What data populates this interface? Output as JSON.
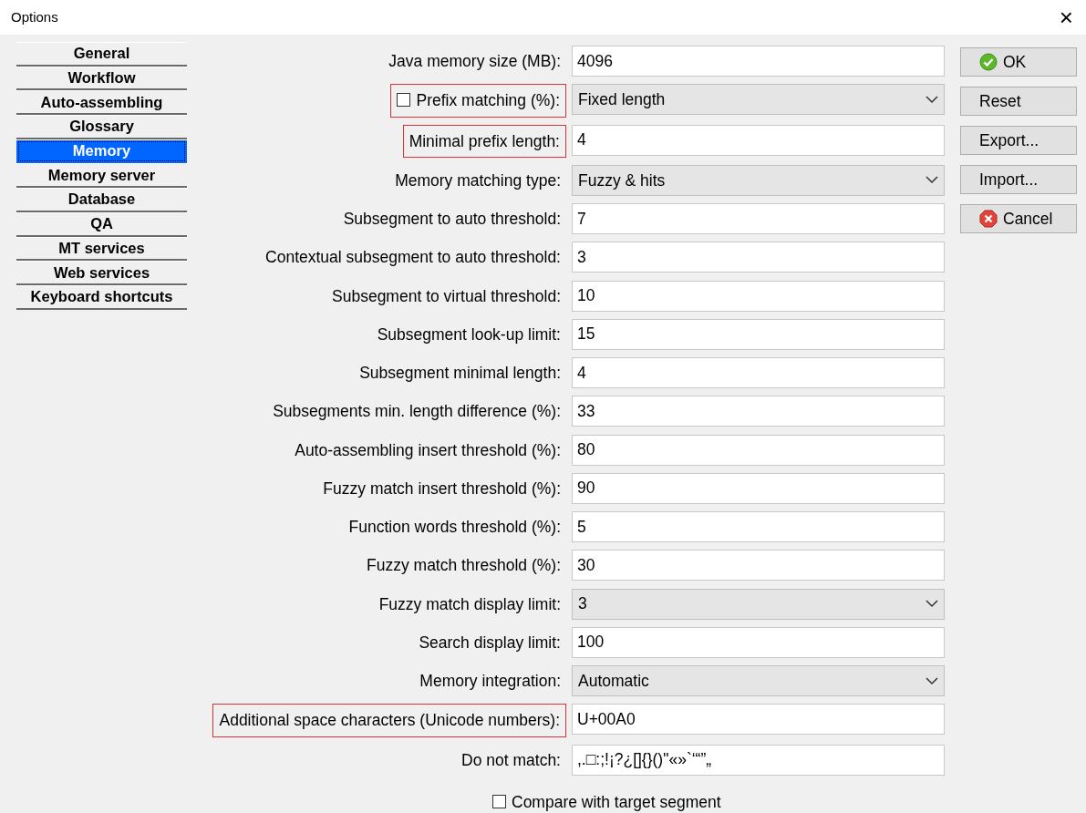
{
  "window": {
    "title": "Options",
    "close": "×"
  },
  "sidebar": {
    "items": [
      {
        "label": "General",
        "selected": false
      },
      {
        "label": "Workflow",
        "selected": false
      },
      {
        "label": "Auto-assembling",
        "selected": false
      },
      {
        "label": "Glossary",
        "selected": false
      },
      {
        "label": "Memory",
        "selected": true
      },
      {
        "label": "Memory server",
        "selected": false
      },
      {
        "label": "Database",
        "selected": false
      },
      {
        "label": "QA",
        "selected": false
      },
      {
        "label": "MT services",
        "selected": false
      },
      {
        "label": "Web services",
        "selected": false
      },
      {
        "label": "Keyboard shortcuts",
        "selected": false
      }
    ]
  },
  "settings": [
    {
      "label": "Java memory size (MB):",
      "kind": "text",
      "value": "4096",
      "highlighted": false
    },
    {
      "label": "Prefix matching (%):",
      "kind": "select",
      "value": "Fixed length",
      "highlighted": true,
      "checked": false
    },
    {
      "label": "Minimal prefix length:",
      "kind": "text",
      "value": "4",
      "highlighted": true
    },
    {
      "label": "Memory matching type:",
      "kind": "select",
      "value": "Fuzzy & hits",
      "highlighted": false
    },
    {
      "label": "Subsegment to auto threshold:",
      "kind": "text",
      "value": "7",
      "highlighted": false
    },
    {
      "label": "Contextual subsegment to auto threshold:",
      "kind": "text",
      "value": "3",
      "highlighted": false
    },
    {
      "label": "Subsegment to virtual threshold:",
      "kind": "text",
      "value": "10",
      "highlighted": false
    },
    {
      "label": "Subsegment look-up limit:",
      "kind": "text",
      "value": "15",
      "highlighted": false
    },
    {
      "label": "Subsegment minimal length:",
      "kind": "text",
      "value": "4",
      "highlighted": false
    },
    {
      "label": "Subsegments min. length difference (%):",
      "kind": "text",
      "value": "33",
      "highlighted": false
    },
    {
      "label": "Auto-assembling insert threshold (%):",
      "kind": "text",
      "value": "80",
      "highlighted": false
    },
    {
      "label": "Fuzzy match insert threshold (%):",
      "kind": "text",
      "value": "90",
      "highlighted": false
    },
    {
      "label": "Function words threshold (%):",
      "kind": "text",
      "value": "5",
      "highlighted": false
    },
    {
      "label": "Fuzzy match threshold (%):",
      "kind": "text",
      "value": "30",
      "highlighted": false
    },
    {
      "label": "Fuzzy match display limit:",
      "kind": "select",
      "value": "3",
      "highlighted": false
    },
    {
      "label": "Search display limit:",
      "kind": "text",
      "value": "100",
      "highlighted": false
    },
    {
      "label": "Memory integration:",
      "kind": "select",
      "value": "Automatic",
      "highlighted": false
    },
    {
      "label": "Additional space characters (Unicode numbers):",
      "kind": "text",
      "value": "U+00A0",
      "highlighted": true
    },
    {
      "label": "Do not match:",
      "kind": "text",
      "value": ",.□:;!¡?¿[]{}()\"«»`‘“”„",
      "highlighted": false
    }
  ],
  "compare_checkbox": {
    "label": "Compare with target segment",
    "checked": false
  },
  "buttons": [
    {
      "label": "OK",
      "kind": "ok"
    },
    {
      "label": "Reset",
      "kind": "plain"
    },
    {
      "label": "Export...",
      "kind": "plain"
    },
    {
      "label": "Import...",
      "kind": "plain"
    },
    {
      "label": "Cancel",
      "kind": "cancel"
    }
  ]
}
